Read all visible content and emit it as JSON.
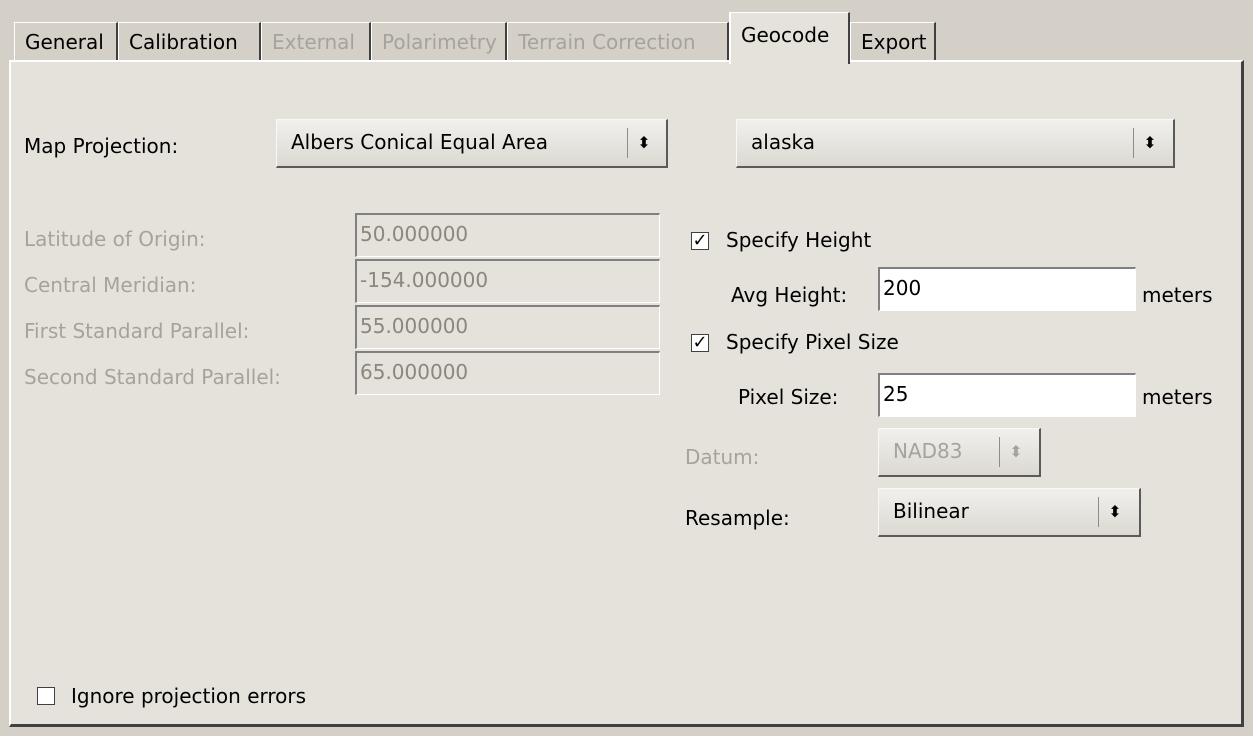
{
  "tabs": [
    {
      "label": "General",
      "state": "normal"
    },
    {
      "label": "Calibration",
      "state": "normal"
    },
    {
      "label": "External",
      "state": "disabled"
    },
    {
      "label": "Polarimetry",
      "state": "disabled"
    },
    {
      "label": "Terrain Correction",
      "state": "disabled"
    },
    {
      "label": "Geocode",
      "state": "active"
    },
    {
      "label": "Export",
      "state": "normal"
    }
  ],
  "map_projection": {
    "label": "Map Projection:",
    "projection_value": "Albers Conical Equal Area",
    "preset_value": "alaska"
  },
  "parameters": [
    {
      "label": "Latitude of Origin:",
      "value": "50.000000"
    },
    {
      "label": "Central Meridian:",
      "value": "-154.000000"
    },
    {
      "label": "First Standard Parallel:",
      "value": "55.000000"
    },
    {
      "label": "Second Standard Parallel:",
      "value": "65.000000"
    }
  ],
  "height": {
    "checkbox_label": "Specify Height",
    "checked": true,
    "field_label": "Avg Height:",
    "value": "200",
    "unit": "meters"
  },
  "pixel_size": {
    "checkbox_label": "Specify Pixel Size",
    "checked": true,
    "field_label": "Pixel Size:",
    "value": "25",
    "unit": "meters"
  },
  "datum": {
    "label": "Datum:",
    "value": "NAD83"
  },
  "resample": {
    "label": "Resample:",
    "value": "Bilinear"
  },
  "ignore_errors": {
    "label": "Ignore projection errors",
    "checked": false
  },
  "glyphs": {
    "check": "✓",
    "updown": "⬍"
  }
}
